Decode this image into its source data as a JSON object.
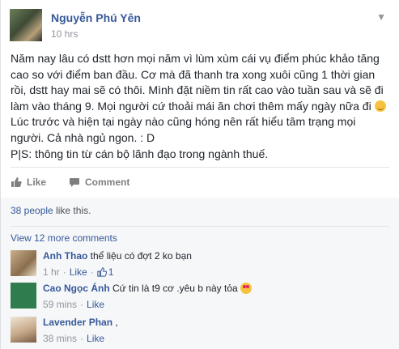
{
  "post": {
    "author": "Nguyễn Phú Yên",
    "time": "10 hrs",
    "text_lines": [
      "Năm nay lâu có dstt hơn mọi năm vì lùm xùm cái vụ điểm phúc khảo tăng",
      "cao so với điểm ban đầu. Cơ mà đã thanh tra xong xuôi cũng 1 thời gian",
      "rồi, dstt hay mai sẽ có thôi. Mình đặt niềm tin rất cao vào tuần sau và sẽ đi",
      "làm vào tháng 9. Mọi người cứ thoải mái ăn chơi thêm mấy ngày nữa đi",
      "Lúc trước và hiện tại ngày nào cũng hóng nên rất hiểu tâm trạng mọi",
      "người. Cả nhà ngủ ngon. : D",
      "P|S: thông tin từ cán bộ lãnh đạo trong ngành thuế."
    ]
  },
  "actions": {
    "like_label": "Like",
    "comment_label": "Comment"
  },
  "likes_summary": {
    "count_link": "38 people",
    "suffix": " like this."
  },
  "view_more": "View 12 more comments",
  "comments": [
    {
      "name": "Anh Thao",
      "text": "thể liệu có đợt 2 ko bạn",
      "time": "1 hr",
      "like_label": "Like",
      "like_count": "1",
      "avatar_color": "#a78b6a"
    },
    {
      "name": "Cao Ngọc Ánh",
      "text": "Cứ tin là t9 cơ .yêu b này tỏa",
      "time": "59 mins",
      "like_label": "Like",
      "avatar_color": "#2f7d4f"
    },
    {
      "name": "Lavender Phan",
      "text": ",",
      "time": "38 mins",
      "like_label": "Like",
      "avatar_color": "#d9c9b0"
    }
  ],
  "icons": {
    "chevron": "chevron-down-icon",
    "like": "thumbs-up-icon",
    "comment": "speech-bubble-icon"
  },
  "colors": {
    "link_blue": "#365899",
    "muted": "#90949c",
    "text": "#1d2129"
  }
}
